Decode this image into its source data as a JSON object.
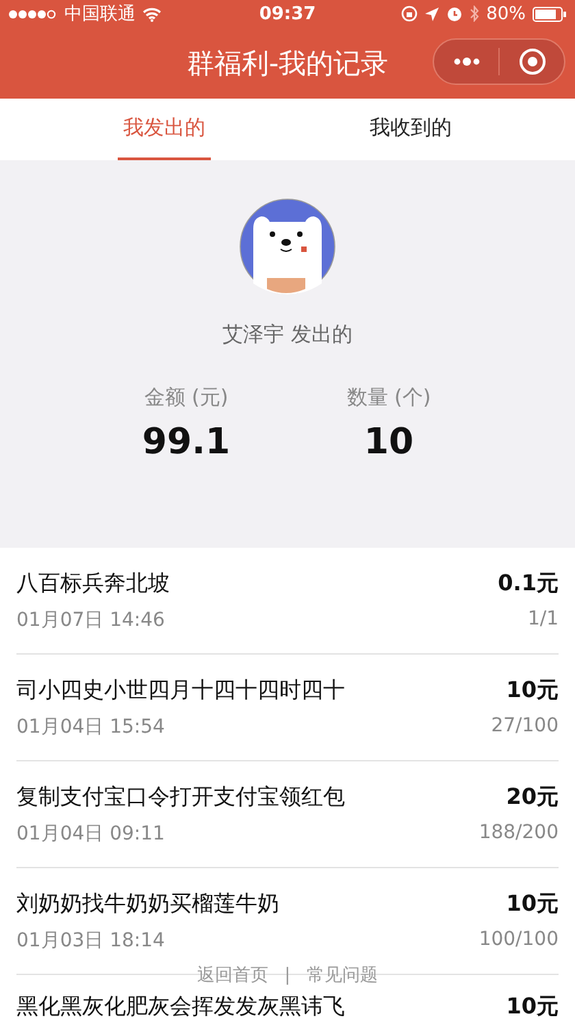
{
  "status_bar": {
    "carrier": "中国联通",
    "time": "09:37",
    "battery": "80%"
  },
  "nav": {
    "title": "群福利-我的记录"
  },
  "tabs": [
    {
      "label": "我发出的",
      "selected": true
    },
    {
      "label": "我收到的",
      "selected": false
    }
  ],
  "profile": {
    "name": "艾泽宇",
    "suffix": "发出的"
  },
  "stats": [
    {
      "label": "金额 (元)",
      "value": "99.1"
    },
    {
      "label": "数量 (个)",
      "value": "10"
    }
  ],
  "records": [
    {
      "title": "八百标兵奔北坡",
      "time": "01月07日 14:46",
      "amount": "0.1元",
      "count": "1/1"
    },
    {
      "title": "司小四史小世四月十四十四时四十",
      "time": "01月04日 15:54",
      "amount": "10元",
      "count": "27/100"
    },
    {
      "title": "复制支付宝口令打开支付宝领红包",
      "time": "01月04日 09:11",
      "amount": "20元",
      "count": "188/200"
    },
    {
      "title": "刘奶奶找牛奶奶买榴莲牛奶",
      "time": "01月03日 18:14",
      "amount": "10元",
      "count": "100/100"
    },
    {
      "title": "黑化黑灰化肥灰会挥发发灰黑讳飞",
      "amount": "10元"
    }
  ],
  "footer": {
    "links": [
      "返回首页",
      "常见问题"
    ],
    "separator": "|"
  }
}
